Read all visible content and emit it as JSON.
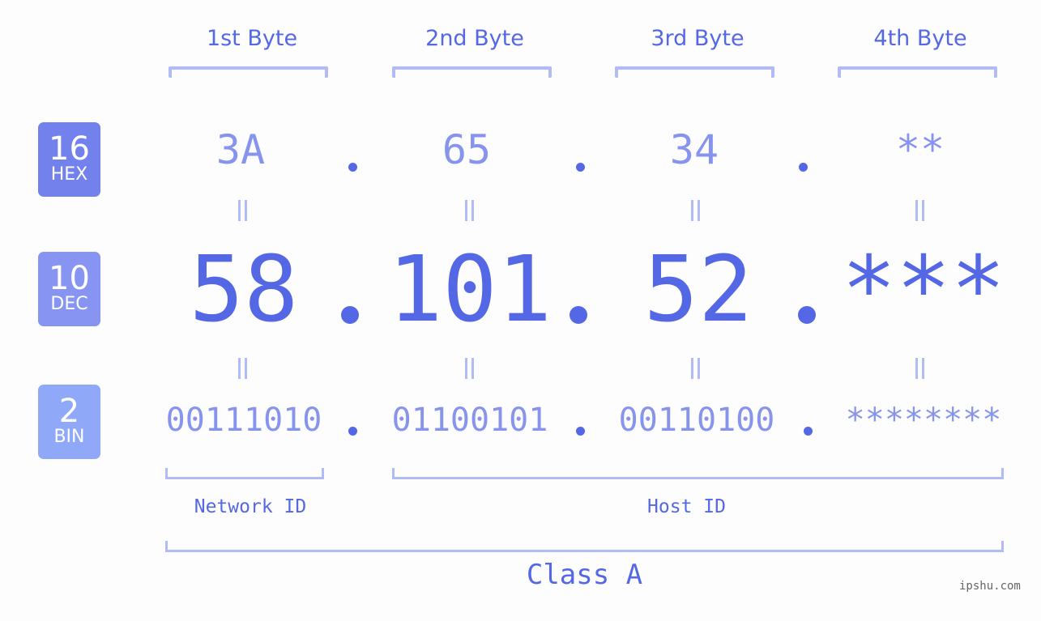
{
  "byte_headers": [
    "1st Byte",
    "2nd Byte",
    "3rd Byte",
    "4th Byte"
  ],
  "badges": [
    {
      "num": "16",
      "label": "HEX",
      "color": "#7281ec"
    },
    {
      "num": "10",
      "label": "DEC",
      "color": "#8794f1"
    },
    {
      "num": "2",
      "label": "BIN",
      "color": "#8fa8f8"
    }
  ],
  "hex": [
    "3A",
    "65",
    "34",
    "**"
  ],
  "dec": [
    "58",
    "101",
    "52",
    "***"
  ],
  "bin": [
    "00111010",
    "01100101",
    "00110100",
    "********"
  ],
  "network_id_label": "Network ID",
  "host_id_label": "Host ID",
  "class_label": "Class A",
  "watermark": "ipshu.com",
  "colors": {
    "primary": "#5468e6",
    "light": "#8794ee",
    "bracket": "#b1bbf6"
  }
}
